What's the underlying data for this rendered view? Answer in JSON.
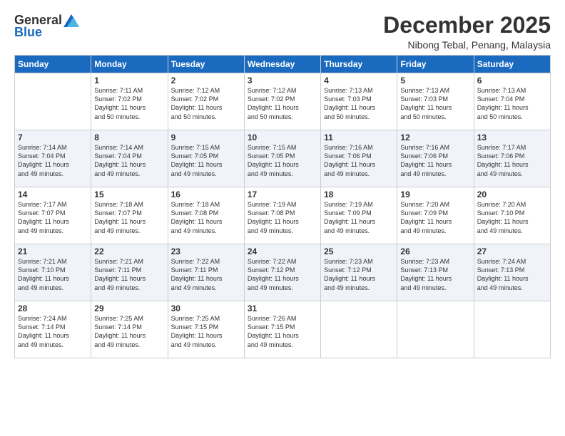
{
  "logo": {
    "general": "General",
    "blue": "Blue"
  },
  "title": "December 2025",
  "subtitle": "Nibong Tebal, Penang, Malaysia",
  "days_of_week": [
    "Sunday",
    "Monday",
    "Tuesday",
    "Wednesday",
    "Thursday",
    "Friday",
    "Saturday"
  ],
  "weeks": [
    [
      {
        "num": "",
        "info": ""
      },
      {
        "num": "1",
        "info": "Sunrise: 7:11 AM\nSunset: 7:02 PM\nDaylight: 11 hours\nand 50 minutes."
      },
      {
        "num": "2",
        "info": "Sunrise: 7:12 AM\nSunset: 7:02 PM\nDaylight: 11 hours\nand 50 minutes."
      },
      {
        "num": "3",
        "info": "Sunrise: 7:12 AM\nSunset: 7:02 PM\nDaylight: 11 hours\nand 50 minutes."
      },
      {
        "num": "4",
        "info": "Sunrise: 7:13 AM\nSunset: 7:03 PM\nDaylight: 11 hours\nand 50 minutes."
      },
      {
        "num": "5",
        "info": "Sunrise: 7:13 AM\nSunset: 7:03 PM\nDaylight: 11 hours\nand 50 minutes."
      },
      {
        "num": "6",
        "info": "Sunrise: 7:13 AM\nSunset: 7:04 PM\nDaylight: 11 hours\nand 50 minutes."
      }
    ],
    [
      {
        "num": "7",
        "info": "Sunrise: 7:14 AM\nSunset: 7:04 PM\nDaylight: 11 hours\nand 49 minutes."
      },
      {
        "num": "8",
        "info": "Sunrise: 7:14 AM\nSunset: 7:04 PM\nDaylight: 11 hours\nand 49 minutes."
      },
      {
        "num": "9",
        "info": "Sunrise: 7:15 AM\nSunset: 7:05 PM\nDaylight: 11 hours\nand 49 minutes."
      },
      {
        "num": "10",
        "info": "Sunrise: 7:15 AM\nSunset: 7:05 PM\nDaylight: 11 hours\nand 49 minutes."
      },
      {
        "num": "11",
        "info": "Sunrise: 7:16 AM\nSunset: 7:06 PM\nDaylight: 11 hours\nand 49 minutes."
      },
      {
        "num": "12",
        "info": "Sunrise: 7:16 AM\nSunset: 7:06 PM\nDaylight: 11 hours\nand 49 minutes."
      },
      {
        "num": "13",
        "info": "Sunrise: 7:17 AM\nSunset: 7:06 PM\nDaylight: 11 hours\nand 49 minutes."
      }
    ],
    [
      {
        "num": "14",
        "info": "Sunrise: 7:17 AM\nSunset: 7:07 PM\nDaylight: 11 hours\nand 49 minutes."
      },
      {
        "num": "15",
        "info": "Sunrise: 7:18 AM\nSunset: 7:07 PM\nDaylight: 11 hours\nand 49 minutes."
      },
      {
        "num": "16",
        "info": "Sunrise: 7:18 AM\nSunset: 7:08 PM\nDaylight: 11 hours\nand 49 minutes."
      },
      {
        "num": "17",
        "info": "Sunrise: 7:19 AM\nSunset: 7:08 PM\nDaylight: 11 hours\nand 49 minutes."
      },
      {
        "num": "18",
        "info": "Sunrise: 7:19 AM\nSunset: 7:09 PM\nDaylight: 11 hours\nand 49 minutes."
      },
      {
        "num": "19",
        "info": "Sunrise: 7:20 AM\nSunset: 7:09 PM\nDaylight: 11 hours\nand 49 minutes."
      },
      {
        "num": "20",
        "info": "Sunrise: 7:20 AM\nSunset: 7:10 PM\nDaylight: 11 hours\nand 49 minutes."
      }
    ],
    [
      {
        "num": "21",
        "info": "Sunrise: 7:21 AM\nSunset: 7:10 PM\nDaylight: 11 hours\nand 49 minutes."
      },
      {
        "num": "22",
        "info": "Sunrise: 7:21 AM\nSunset: 7:11 PM\nDaylight: 11 hours\nand 49 minutes."
      },
      {
        "num": "23",
        "info": "Sunrise: 7:22 AM\nSunset: 7:11 PM\nDaylight: 11 hours\nand 49 minutes."
      },
      {
        "num": "24",
        "info": "Sunrise: 7:22 AM\nSunset: 7:12 PM\nDaylight: 11 hours\nand 49 minutes."
      },
      {
        "num": "25",
        "info": "Sunrise: 7:23 AM\nSunset: 7:12 PM\nDaylight: 11 hours\nand 49 minutes."
      },
      {
        "num": "26",
        "info": "Sunrise: 7:23 AM\nSunset: 7:13 PM\nDaylight: 11 hours\nand 49 minutes."
      },
      {
        "num": "27",
        "info": "Sunrise: 7:24 AM\nSunset: 7:13 PM\nDaylight: 11 hours\nand 49 minutes."
      }
    ],
    [
      {
        "num": "28",
        "info": "Sunrise: 7:24 AM\nSunset: 7:14 PM\nDaylight: 11 hours\nand 49 minutes."
      },
      {
        "num": "29",
        "info": "Sunrise: 7:25 AM\nSunset: 7:14 PM\nDaylight: 11 hours\nand 49 minutes."
      },
      {
        "num": "30",
        "info": "Sunrise: 7:25 AM\nSunset: 7:15 PM\nDaylight: 11 hours\nand 49 minutes."
      },
      {
        "num": "31",
        "info": "Sunrise: 7:26 AM\nSunset: 7:15 PM\nDaylight: 11 hours\nand 49 minutes."
      },
      {
        "num": "",
        "info": ""
      },
      {
        "num": "",
        "info": ""
      },
      {
        "num": "",
        "info": ""
      }
    ]
  ]
}
